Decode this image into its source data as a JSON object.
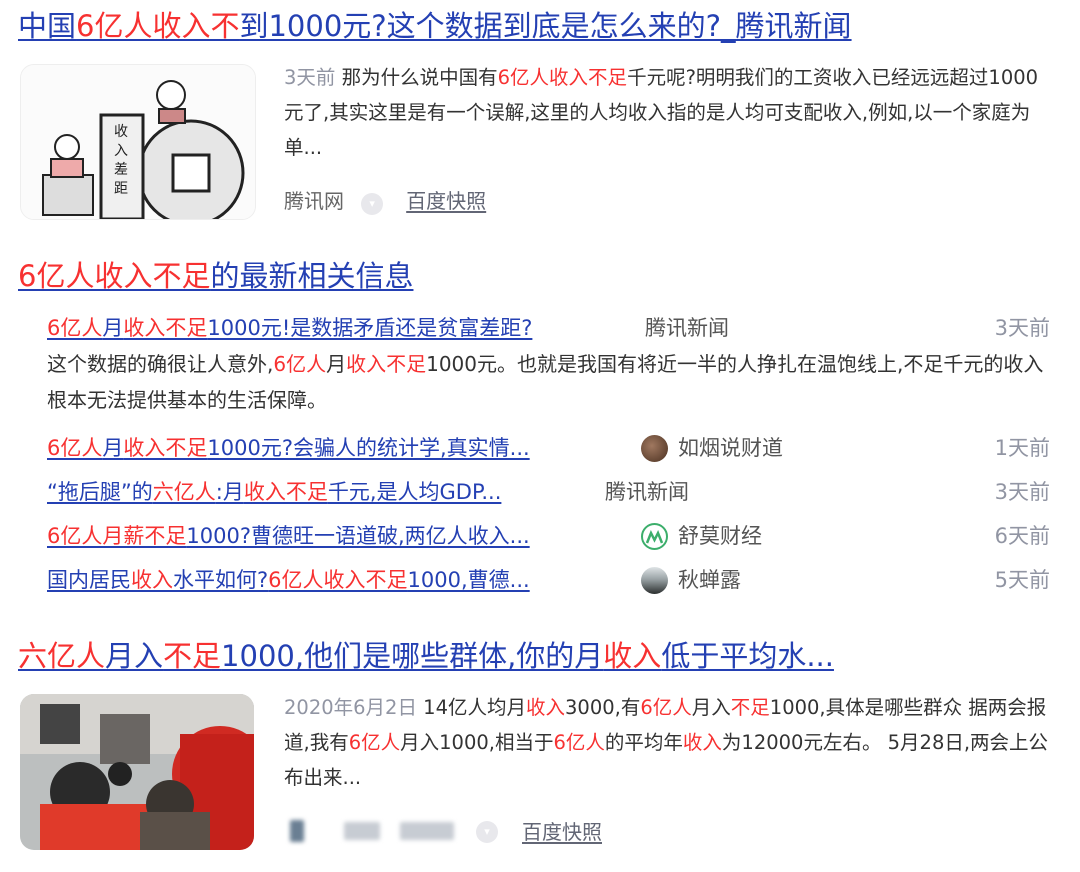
{
  "result1": {
    "title_parts": [
      {
        "t": "中国",
        "h": false
      },
      {
        "t": "6亿人收入不",
        "h": true
      },
      {
        "t": "到1000元?这个数据到底是怎么来的?_腾讯新闻",
        "h": false
      }
    ],
    "time": "3天前",
    "snippet_parts": [
      {
        "t": "那为什么说中国有",
        "h": false
      },
      {
        "t": "6亿人收入不足",
        "h": true
      },
      {
        "t": "千元呢?明明我们的工资收入已经远远超过1000元了,其实这里是有一个误解,这里的人均收入指的是人均可支配收入,例如,以一个家庭为单...",
        "h": false
      }
    ],
    "source": "腾讯网",
    "snapshot": "百度快照",
    "thumb_labels": [
      "收",
      "入",
      "差",
      "距"
    ]
  },
  "news_section": {
    "title_parts": [
      {
        "t": "6亿人收入不足",
        "h": true
      },
      {
        "t": "的最新相关信息",
        "h": false
      }
    ],
    "top": {
      "title_parts": [
        {
          "t": "6亿人",
          "h": true
        },
        {
          "t": "月",
          "h": false
        },
        {
          "t": "收入不足",
          "h": true
        },
        {
          "t": "1000元!是数据矛盾还是贫富差距?",
          "h": false
        }
      ],
      "source": "腾讯新闻",
      "date": "3天前",
      "desc_parts": [
        {
          "t": "这个数据的确很让人意外,",
          "h": false
        },
        {
          "t": "6亿人",
          "h": true
        },
        {
          "t": "月",
          "h": false
        },
        {
          "t": "收入不足",
          "h": true
        },
        {
          "t": "1000元。也就是我国有将近一半的人挣扎在温饱线上,不足千元的收入根本无法提供基本的生活保障。",
          "h": false
        }
      ]
    },
    "items": [
      {
        "title_parts": [
          {
            "t": "6亿人",
            "h": true
          },
          {
            "t": "月",
            "h": false
          },
          {
            "t": "收入不足",
            "h": true
          },
          {
            "t": "1000元?会骗人的统计学,真实情...",
            "h": false
          }
        ],
        "source": "如烟说财道",
        "date": "1天前",
        "avatar": "brown"
      },
      {
        "title_parts": [
          {
            "t": "“拖后腿”的",
            "h": false
          },
          {
            "t": "六亿人",
            "h": true
          },
          {
            "t": ":月",
            "h": false
          },
          {
            "t": "收入不足",
            "h": true
          },
          {
            "t": "千元,是人均GDP...",
            "h": false
          }
        ],
        "source": "腾讯新闻",
        "date": "3天前",
        "avatar": ""
      },
      {
        "title_parts": [
          {
            "t": "6亿人月薪不足",
            "h": true
          },
          {
            "t": "1000?曹德旺一语道破,两亿人收入...",
            "h": false
          }
        ],
        "source": "舒莫财经",
        "date": "6天前",
        "avatar": "green"
      },
      {
        "title_parts": [
          {
            "t": "国内居民",
            "h": false
          },
          {
            "t": "收入",
            "h": true
          },
          {
            "t": "水平如何?",
            "h": false
          },
          {
            "t": "6亿人收入不足",
            "h": true
          },
          {
            "t": "1000,曹德...",
            "h": false
          }
        ],
        "source": "秋蝉露",
        "date": "5天前",
        "avatar": "dark"
      }
    ]
  },
  "result3": {
    "title_parts": [
      {
        "t": "六亿人",
        "h": true
      },
      {
        "t": "月入",
        "h": false
      },
      {
        "t": "不足",
        "h": true
      },
      {
        "t": "1000,他们是哪些群体,你的月",
        "h": false
      },
      {
        "t": "收入",
        "h": true
      },
      {
        "t": "低于平均水...",
        "h": false
      }
    ],
    "time": "2020年6月2日",
    "snippet_parts": [
      {
        "t": "14亿人均月",
        "h": false
      },
      {
        "t": "收入",
        "h": true
      },
      {
        "t": "3000,有",
        "h": false
      },
      {
        "t": "6亿人",
        "h": true
      },
      {
        "t": "月入",
        "h": false
      },
      {
        "t": "不足",
        "h": true
      },
      {
        "t": "1000,具体是哪些群众 据两会报道,我有",
        "h": false
      },
      {
        "t": "6亿人",
        "h": true
      },
      {
        "t": "月入1000,相当于",
        "h": false
      },
      {
        "t": "6亿人",
        "h": true
      },
      {
        "t": "的平均年",
        "h": false
      },
      {
        "t": "收入",
        "h": true
      },
      {
        "t": "为12000元左右。 5月28日,两会上公布出来...",
        "h": false
      }
    ],
    "snapshot": "百度快照"
  },
  "colors": {
    "link": "#2440b3",
    "highlight": "#f73131",
    "time": "#9195a3",
    "source": "#666666"
  }
}
